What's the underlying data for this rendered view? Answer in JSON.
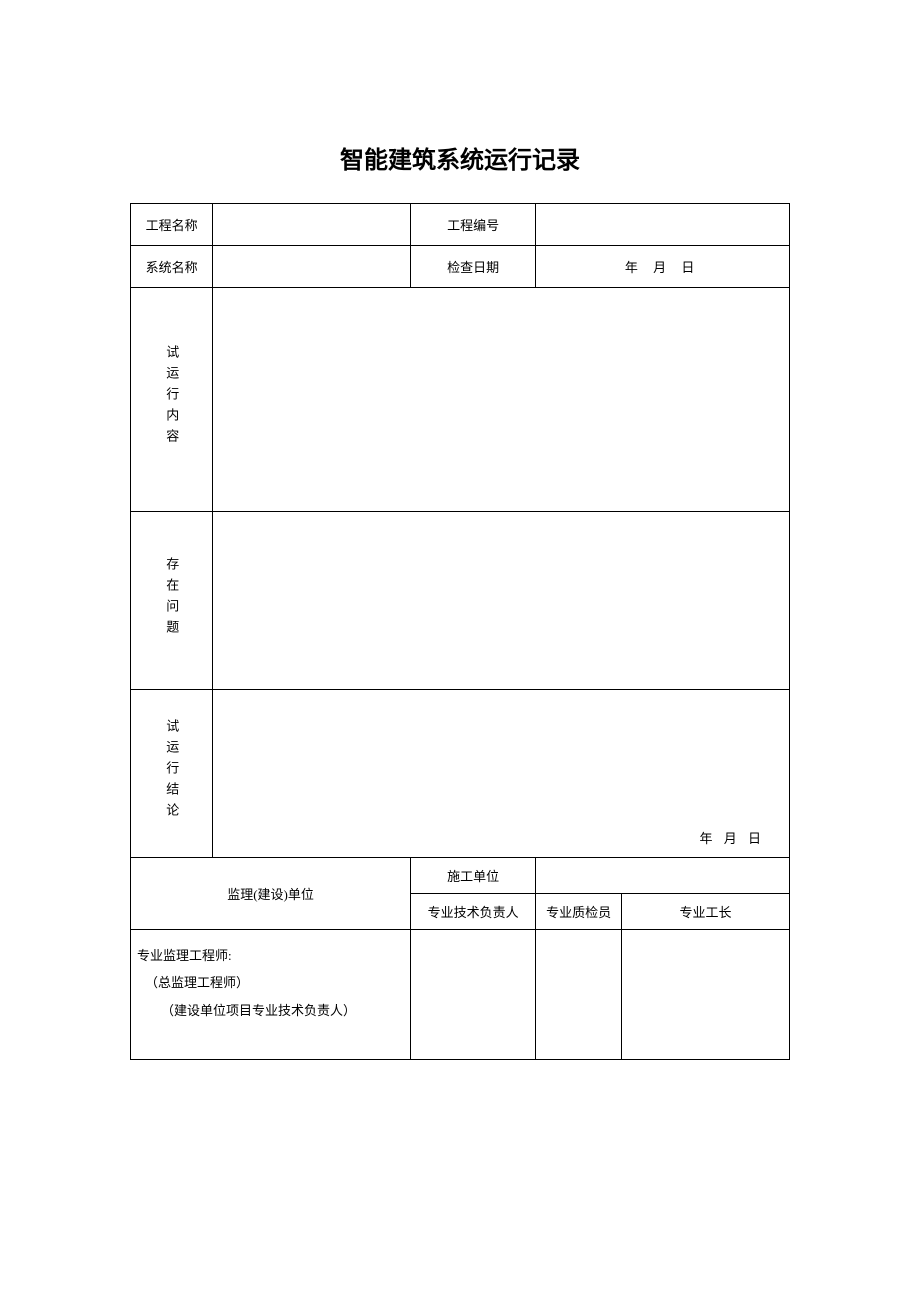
{
  "title": "智能建筑系统运行记录",
  "labels": {
    "project_name": "工程名称",
    "project_no": "工程编号",
    "system_name": "系统名称",
    "check_date": "检查日期",
    "trial_content": "试运行内容",
    "issues": "存在问题",
    "trial_conclusion": "试运行结论",
    "supervision_unit": "监理(建设)单位",
    "construction_unit": "施工单位",
    "tech_lead": "专业技术负责人",
    "quality_inspector": "专业质检员",
    "foreman": "专业工长"
  },
  "values": {
    "project_name": "",
    "project_no": "",
    "system_name": "",
    "check_date": "年 月 日",
    "trial_content": "",
    "issues": "",
    "trial_conclusion": "",
    "conclusion_date": "年 月 日",
    "construction_unit": "",
    "tech_lead_val": "",
    "quality_inspector_val": "",
    "foreman_val": ""
  },
  "signatures": {
    "line1": "专业监理工程师:",
    "line2": "（总监理工程师）",
    "line3": "（建设单位项目专业技术负责人）"
  }
}
